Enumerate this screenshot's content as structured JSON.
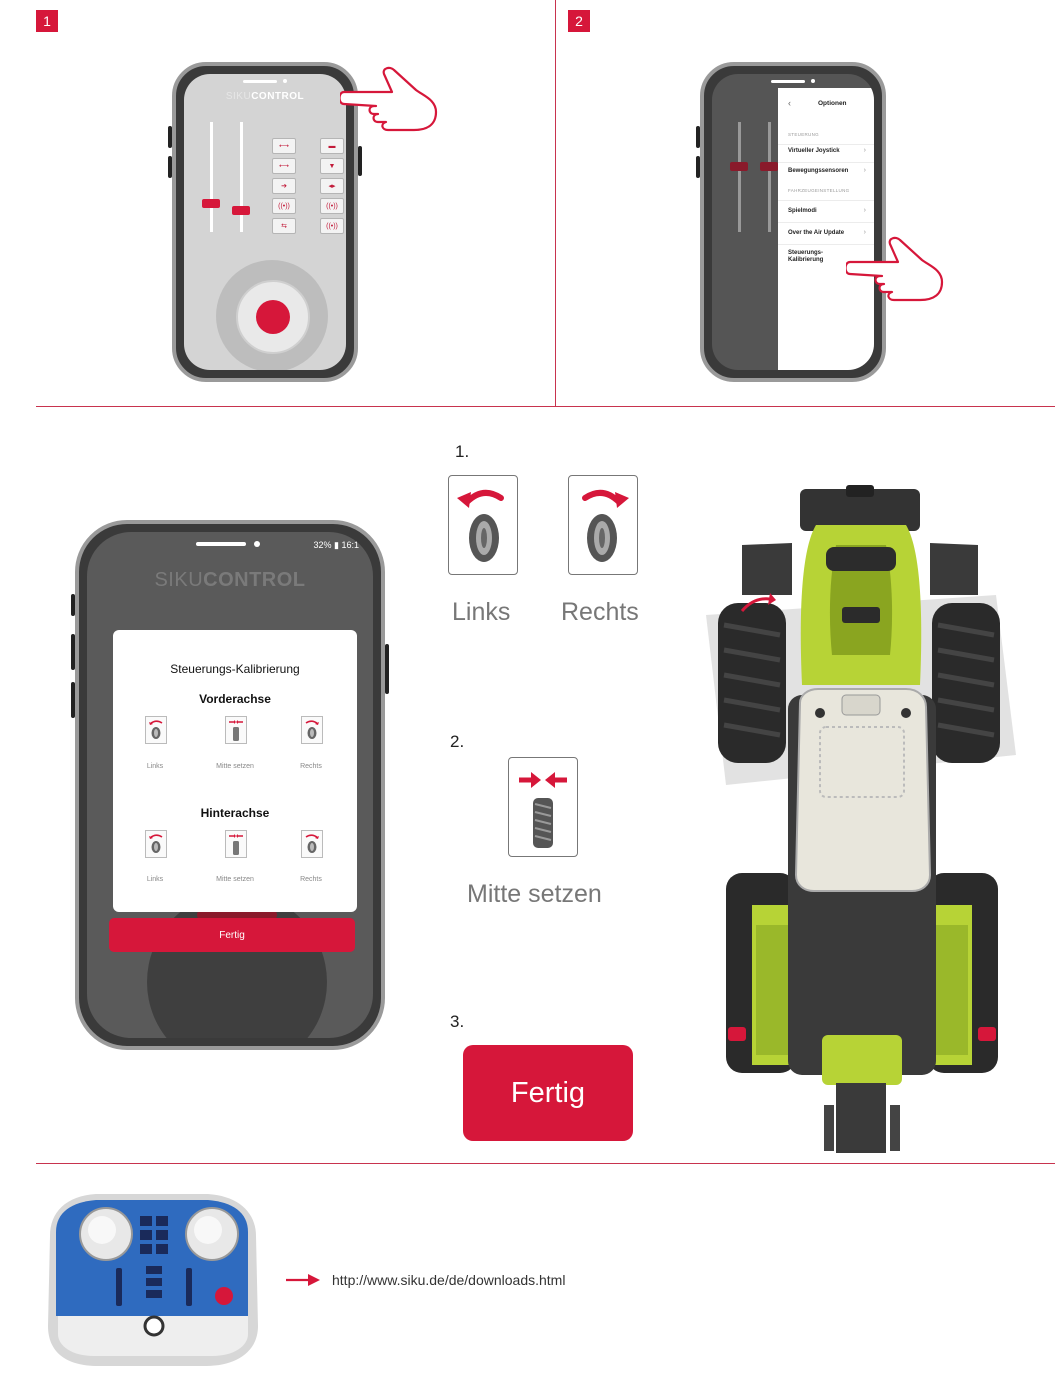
{
  "steps": {
    "step1_badge": "1",
    "step2_badge": "2"
  },
  "app": {
    "logo_prefix": "SIKU",
    "logo_suffix": "CONTROL",
    "status_bar": "32% ▮ 16:1"
  },
  "options_menu": {
    "title": "Optionen",
    "items": [
      {
        "label": "Virtueller Joystick"
      },
      {
        "label": "Bewegungssensoren"
      },
      {
        "label": "Spielmodi"
      },
      {
        "label": "Over the Air Update"
      },
      {
        "label": "Steuerungs-Kalibrierung"
      }
    ]
  },
  "calibration_dialog": {
    "title": "Steuerungs-Kalibrierung",
    "front_axle": "Vorderachse",
    "rear_axle": "Hinterachse",
    "left": "Links",
    "center": "Mitte setzen",
    "right": "Rechts",
    "done": "Fertig"
  },
  "instructions": {
    "step1": "1.",
    "step2": "2.",
    "step3": "3.",
    "left": "Links",
    "right": "Rechts",
    "center": "Mitte setzen",
    "done": "Fertig"
  },
  "footer": {
    "download_link": "http://www.siku.de/de/downloads.html"
  },
  "colors": {
    "accent": "#d6173a",
    "divider": "#c8334e",
    "tractor_green": "#b7d336"
  }
}
